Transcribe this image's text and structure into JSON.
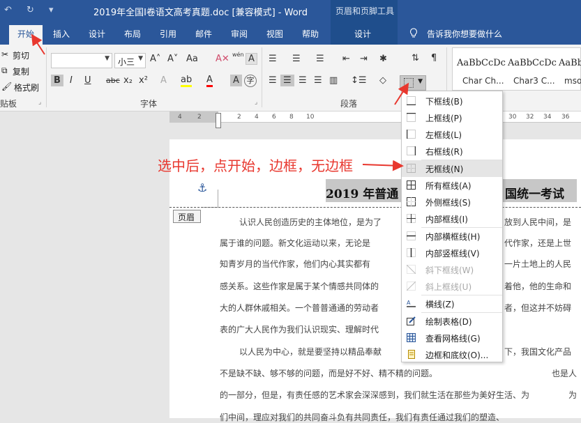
{
  "window": {
    "title": "2019年全国I卷语文高考真题.doc [兼容模式]  -  Word",
    "context_title": "页眉和页脚工具"
  },
  "qat": {
    "undo": "↶",
    "redo": "↻",
    "customize": "▾"
  },
  "tabs": [
    {
      "label": "开始",
      "active": true
    },
    {
      "label": "插入"
    },
    {
      "label": "设计"
    },
    {
      "label": "布局"
    },
    {
      "label": "引用"
    },
    {
      "label": "邮件"
    },
    {
      "label": "审阅"
    },
    {
      "label": "视图"
    },
    {
      "label": "帮助"
    },
    {
      "label": "设计"
    }
  ],
  "tell_me": "告诉我你想要做什么",
  "clipboard": {
    "cut": "剪切",
    "copy": "复制",
    "format_painter": "格式刷",
    "group_label": "贴板"
  },
  "font": {
    "name_value": "",
    "size_value": "小三",
    "group_label": "字体",
    "grow": "A˄",
    "shrink": "A˅",
    "change_case": "Aa",
    "clear_formatting": "A✕",
    "phonetic": "wén",
    "char_border": "A",
    "bold": "B",
    "italic": "I",
    "underline": "U",
    "strikethrough": "abc",
    "subscript": "x₂",
    "superscript": "x²",
    "text_effect": "A",
    "highlight": "ab",
    "font_color": "A",
    "char_shading": "A",
    "enclose": "字"
  },
  "paragraph": {
    "group_label": "段落"
  },
  "styles": [
    {
      "sample": "AaBbCcDc",
      "name": "Char Ch..."
    },
    {
      "sample": "AaBbCcDc",
      "name": "Char3 C..."
    },
    {
      "sample": "AaBb",
      "name": "msor"
    }
  ],
  "ruler": {
    "ticks": [
      "4",
      "2",
      "2",
      "4",
      "6",
      "8",
      "10",
      "30",
      "32",
      "34",
      "36"
    ]
  },
  "document": {
    "header_title_left": "2019 年普通",
    "header_title_right": "国统一考试",
    "header_label": "页眉",
    "anchor": "⚓",
    "lines": [
      "认识人民创造历史的主体地位，是为了",
      "属于谁的问题。新文化运动以来，无论是",
      "知青岁月的当代作家，他们内心其实都有",
      "感关系。这些作家是属于某个情感共同体的",
      "大的人群休戚相关。一个普普通通的劳动者",
      "表的广大人民作为我们认识现实、理解时代",
      "以人民为中心，就是要坚持以精品奉献",
      "不是缺不缺、够不够的问题，而是好不好、精不精的问题。",
      "的一部分，但是，有责任感的艺术家会深深感到，我们就生活在那些为美好生活、为",
      "们中间，理应对我们的共同奋斗负有共同责任，我们有责任通过我们的塑造、"
    ],
    "right_fragments": [
      "放到人民中间，是",
      "代作家，还是上世",
      "一片土地上的人民",
      "着他，他的生命和",
      "者，但这并不妨碍",
      "下，我国文化产品",
      "也是人",
      "为"
    ]
  },
  "annotation": "选中后，点开始，边框，无边框",
  "border_menu": {
    "items": [
      {
        "label": "下框线(B)",
        "icon": "bottom-border-icon"
      },
      {
        "label": "上框线(P)",
        "icon": "top-border-icon"
      },
      {
        "label": "左框线(L)",
        "icon": "left-border-icon"
      },
      {
        "label": "右框线(R)",
        "icon": "right-border-icon"
      },
      {
        "label": "无框线(N)",
        "icon": "no-border-icon",
        "selected": true
      },
      {
        "label": "所有框线(A)",
        "icon": "all-borders-icon"
      },
      {
        "label": "外侧框线(S)",
        "icon": "outside-borders-icon"
      },
      {
        "label": "内部框线(I)",
        "icon": "inside-borders-icon"
      },
      {
        "label": "内部横框线(H)",
        "icon": "inside-horizontal-border-icon"
      },
      {
        "label": "内部竖框线(V)",
        "icon": "inside-vertical-border-icon"
      },
      {
        "label": "斜下框线(W)",
        "icon": "diagonal-down-border-icon",
        "disabled": true
      },
      {
        "label": "斜上框线(U)",
        "icon": "diagonal-up-border-icon",
        "disabled": true
      },
      {
        "label": "横线(Z)",
        "icon": "horizontal-line-icon"
      },
      {
        "label": "绘制表格(D)",
        "icon": "draw-table-icon"
      },
      {
        "label": "查看网格线(G)",
        "icon": "view-gridlines-icon"
      },
      {
        "label": "边框和底纹(O)...",
        "icon": "borders-shading-icon"
      }
    ]
  },
  "colors": {
    "title_blue": "#2b579a",
    "annotation_red": "#e8372e",
    "highlight_yellow": "#ffff00",
    "font_red": "#ff0000"
  }
}
